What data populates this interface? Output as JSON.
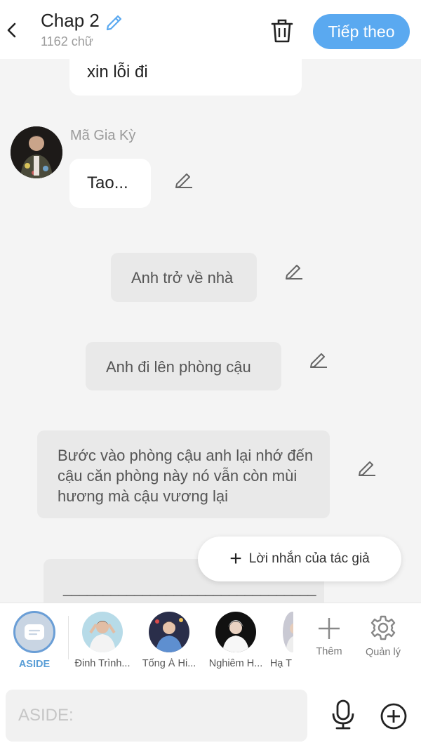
{
  "header": {
    "title": "Chap 2",
    "word_count": "1162 chữ",
    "next_label": "Tiếp theo"
  },
  "messages": {
    "partial_bubble_text": "xin lỗi đi",
    "speaker_name": "Mã Gia Kỳ",
    "speaker_text": "Tao...",
    "narration_1": "Anh trở về nhà",
    "narration_2": "Anh đi lên phòng cậu",
    "narration_3": "Bước vào phòng cậu anh lại nhớ đến cậu căn phòng này nó vẫn còn mùi hương mà cậu vương lại",
    "narration_4": "________________________________"
  },
  "author_note_label": "Lời nhắn của tác giả",
  "characters": [
    {
      "name": "ASIDE",
      "selected": true
    },
    {
      "name": "Đinh Trình..."
    },
    {
      "name": "Tống Á Hi..."
    },
    {
      "name": "Nghiêm H..."
    },
    {
      "name": "Hạ T"
    }
  ],
  "tools": {
    "add_label": "Thêm",
    "manage_label": "Quản lý"
  },
  "input": {
    "placeholder": "ASIDE:"
  },
  "colors": {
    "accent": "#5aa9f0",
    "aside_selected": "#6a9ed6",
    "background": "#f4f4f4"
  }
}
